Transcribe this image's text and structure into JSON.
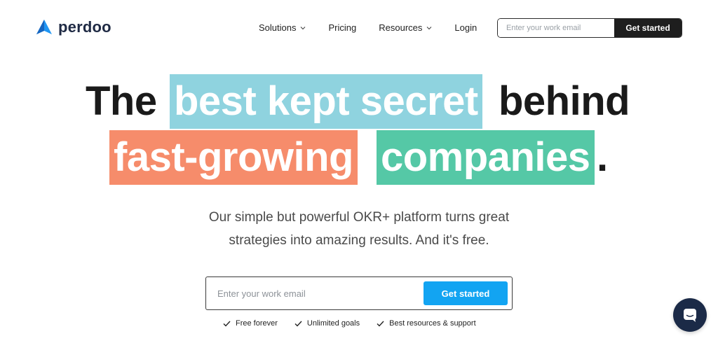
{
  "brand": {
    "name": "perdoo",
    "logo_color": "#2196f3"
  },
  "nav": {
    "items": [
      {
        "label": "Solutions",
        "has_dropdown": true
      },
      {
        "label": "Pricing",
        "has_dropdown": false
      },
      {
        "label": "Resources",
        "has_dropdown": true
      },
      {
        "label": "Login",
        "has_dropdown": false
      }
    ]
  },
  "header_signup": {
    "email_placeholder": "Enter your work email",
    "button_label": "Get started"
  },
  "hero": {
    "headline_line1": {
      "before": "The",
      "highlight": "best kept secret",
      "after": "behind"
    },
    "headline_line2": {
      "highlight1": "fast-growing",
      "highlight2": "companies",
      "after": "."
    },
    "subtext_line1": "Our simple but powerful OKR+ platform turns great",
    "subtext_line2": "strategies into amazing results. And it's free.",
    "email_placeholder": "Enter your work email",
    "button_label": "Get started",
    "features": [
      {
        "label": "Free forever",
        "icon": "check-icon"
      },
      {
        "label": "Unlimited goals",
        "icon": "check-icon"
      },
      {
        "label": "Best resources & support",
        "icon": "check-icon"
      }
    ]
  },
  "colors": {
    "highlight_blue": "#8fd3df",
    "highlight_orange": "#f68c6b",
    "highlight_green": "#55c8a6",
    "cta_blue": "#12a4f2",
    "dark": "#1e1e1e",
    "chat_bg": "#1b2a47"
  },
  "chat": {
    "icon": "chat-bubble-icon"
  }
}
